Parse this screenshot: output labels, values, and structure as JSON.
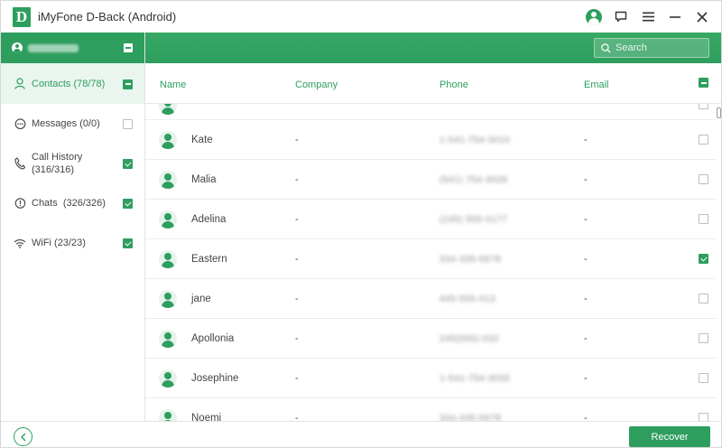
{
  "app": {
    "logo_letter": "D",
    "title": "iMyFone D-Back (Android)"
  },
  "title_controls": [
    "user-account",
    "feedback",
    "menu",
    "minimize",
    "close"
  ],
  "sidebar": {
    "device_name": "████████",
    "items": [
      {
        "label": "Contacts (78/78)",
        "icon": "person-icon",
        "state": "partial"
      },
      {
        "label": "Messages (0/0)",
        "icon": "message-icon",
        "state": "unchecked"
      },
      {
        "label": "Call History (316/316)",
        "icon": "phone-icon",
        "state": "checked"
      },
      {
        "label": "Chats  (326/326)",
        "icon": "chat-icon",
        "state": "checked"
      },
      {
        "label": "WiFi (23/23)",
        "icon": "wifi-icon",
        "state": "checked"
      }
    ]
  },
  "search": {
    "placeholder": "Search"
  },
  "table": {
    "headers": {
      "name": "Name",
      "company": "Company",
      "phone": "Phone",
      "email": "Email"
    },
    "rows": [
      {
        "name": "Kate",
        "company": "-",
        "phone": "1-541-754-3010",
        "email": "-",
        "checked": false
      },
      {
        "name": "Malia",
        "company": "-",
        "phone": "(541) 754-3028",
        "email": "-",
        "checked": false
      },
      {
        "name": "Adelina",
        "company": "-",
        "phone": "(245) 555-0177",
        "email": "-",
        "checked": false
      },
      {
        "name": "Eastern",
        "company": "-",
        "phone": "334-335-5678",
        "email": "-",
        "checked": true
      },
      {
        "name": "jane",
        "company": "-",
        "phone": "445-555-013",
        "email": "-",
        "checked": false
      },
      {
        "name": "Apollonia",
        "company": "-",
        "phone": "245(555)-032",
        "email": "-",
        "checked": false
      },
      {
        "name": "Josephine",
        "company": "-",
        "phone": "1-541-754-3035",
        "email": "-",
        "checked": false
      },
      {
        "name": "Noemi",
        "company": "-",
        "phone": "334-335-5678",
        "email": "-",
        "checked": false
      }
    ]
  },
  "footer": {
    "recover_label": "Recover"
  },
  "colors": {
    "accent": "#2e9e5e",
    "active_bg": "#e9f5ee"
  }
}
